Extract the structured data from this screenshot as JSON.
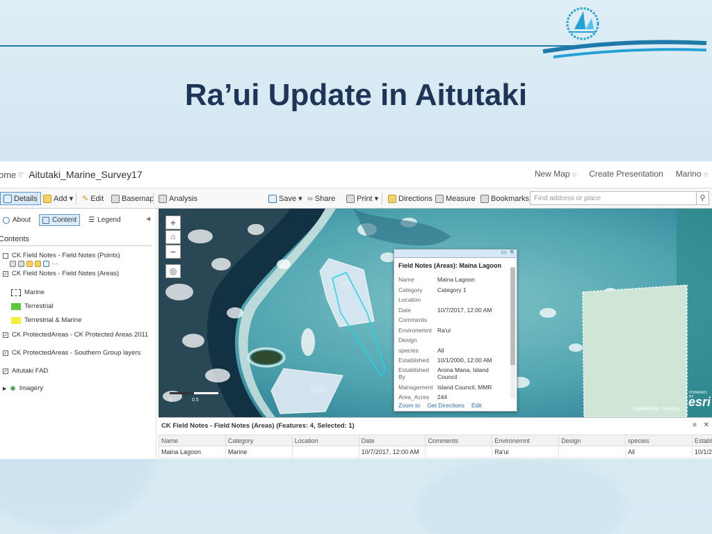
{
  "slide": {
    "title": "Ra’ui Update in Aitutaki",
    "colors": {
      "title": "#1d3556",
      "accent_line": "#1e7aa8",
      "logo": "#27a0d6"
    }
  },
  "app": {
    "home_label": "ome",
    "map_title": "Aitutaki_Marine_Survey17",
    "top_links": [
      "New Map",
      "Create Presentation",
      "Marino"
    ]
  },
  "toolbar": {
    "details": "Details",
    "add": "Add",
    "edit": "Edit",
    "basemap": "Basemap",
    "analysis": "Analysis",
    "save": "Save",
    "share": "Share",
    "print": "Print",
    "directions": "Directions",
    "measure": "Measure",
    "bookmarks": "Bookmarks",
    "search_placeholder": "Find address or place"
  },
  "panel": {
    "tabs": [
      "About",
      "Content",
      "Legend"
    ],
    "heading": "Contents",
    "layers": [
      {
        "label": "CK Field Notes - Field Notes (Points)",
        "checked": false
      },
      {
        "label": "CK Field Notes - Field Notes (Areas)",
        "checked": true
      },
      {
        "label": "CK ProtectedAreas - CK Protected Areas 2011",
        "checked": true
      },
      {
        "label": "CK ProtectedAreas - Southern Group layers",
        "checked": true
      },
      {
        "label": "Aitutaki FAD",
        "checked": true
      },
      {
        "label": "Imagery",
        "checked": false
      }
    ],
    "legend": [
      {
        "label": "Marine",
        "color": "#ffffff"
      },
      {
        "label": "Terrestrial",
        "color": "#5cc83a"
      },
      {
        "label": "Terrestrial & Marine",
        "color": "#f4ef3a"
      }
    ]
  },
  "map": {
    "scale_labels": [
      "0",
      "0.5"
    ],
    "attribution": "DigitalGlobe, GeoEye",
    "esri": "esri",
    "powered_by": "POWERED BY"
  },
  "popup": {
    "title": "Field Notes (Areas): Maina Lagoon",
    "fields": [
      {
        "k": "Name",
        "v": "Maina Lagoon"
      },
      {
        "k": "Category",
        "v": "Category 1"
      },
      {
        "k": "Location",
        "v": ""
      },
      {
        "k": "Date",
        "v": "10/7/2017, 12:00 AM"
      },
      {
        "k": "Comments",
        "v": ""
      },
      {
        "k": "Environemnt",
        "v": "Ra'ui"
      },
      {
        "k": "Design",
        "v": ""
      },
      {
        "k": "species",
        "v": "All"
      },
      {
        "k": "Established",
        "v": "10/1/2000, 12:00 AM"
      },
      {
        "k": "Established By",
        "v": "Arona Mana, Island Council"
      },
      {
        "k": "Management",
        "v": "Island Council, MMR"
      },
      {
        "k": "Area_Acres",
        "v": "244"
      }
    ],
    "links": [
      "Zoom to",
      "Get Directions",
      "Edit"
    ]
  },
  "attribute_table": {
    "heading": "CK Field Notes - Field Notes (Areas) (Features: 4, Selected: 1)",
    "columns": [
      "Name",
      "Category",
      "Location",
      "Date",
      "Comments",
      "Environemnt",
      "Design",
      "species",
      "Establ"
    ],
    "rows": [
      [
        "Maina Lagoon",
        "Marine",
        "",
        "10/7/2017, 12:00 AM",
        "",
        "Ra'ui",
        "",
        "All",
        "10/1/2"
      ]
    ]
  }
}
